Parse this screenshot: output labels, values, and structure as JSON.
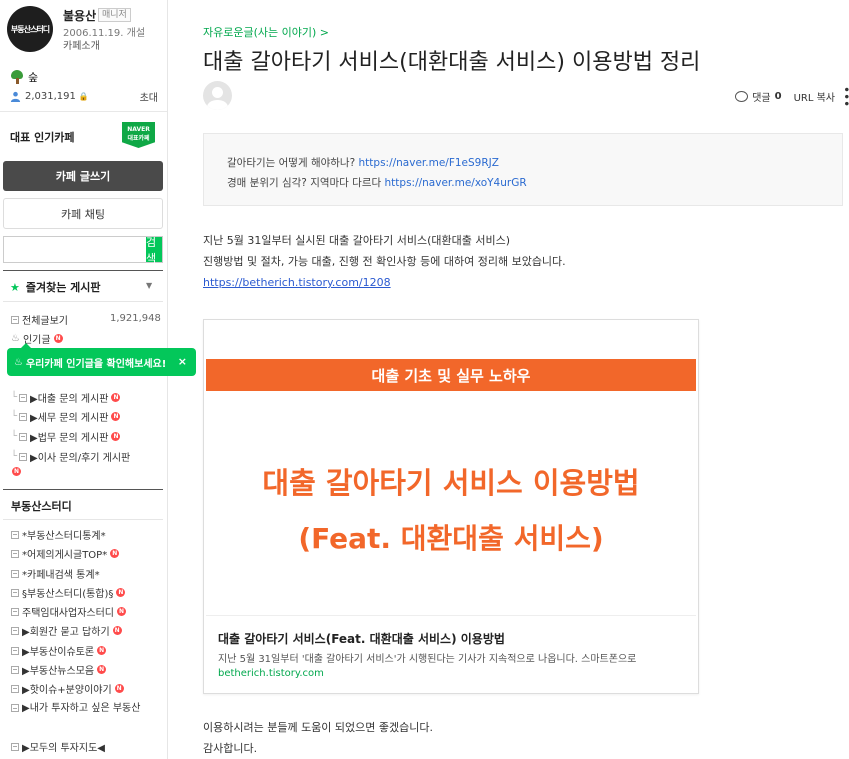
{
  "cafe": {
    "logo_text": "부동산스터디",
    "name": "불용산",
    "manager_label": "매니저",
    "founded": "2006.11.19. 개설",
    "intro_link": "카페소개",
    "rank_label": "숲",
    "member_count": "2,031,191",
    "invite_label": "초대",
    "popular_cafe_label": "대표 인기카페",
    "naver_badge_line1": "NAVER",
    "naver_badge_line2": "대표카페"
  },
  "actions": {
    "write_label": "카페 글쓰기",
    "chat_label": "카페 채팅",
    "search_placeholder": "",
    "search_button": "검색"
  },
  "favorites": {
    "title": "즐겨찾는 게시판"
  },
  "boards": {
    "all_posts": "전체글보기",
    "all_posts_count": "1,921,948",
    "popular": "인기글",
    "toast_text": "우리카페 인기글을 확인해보세요!",
    "toast_close": "×",
    "sub_items": [
      "▶대출 문의 게시판",
      "▶세무 문의 게시판",
      "▶법무 문의 게시판",
      "▶이사 문의/후기 게시판"
    ],
    "group_title": "부동산스터디",
    "group_items": [
      "*부동산스터디통계*",
      "*어제의게시글TOP*",
      "*카페내검색 통계*",
      "§부동산스터디(통합)§",
      "주택임대사업자스터디",
      "▶회원간 묻고 답하기",
      "▶부동산이슈토론",
      "▶부동산뉴스모음",
      "▶핫이슈+분양이야기",
      "▶내가 투자하고 싶은 부동산",
      "▶모두의 투자지도◀"
    ],
    "new_badge": "N"
  },
  "article": {
    "breadcrumb": "자유로운글(사는 이야기) >",
    "title": "대출 갈아타기 서비스(대환대출 서비스) 이용방법 정리",
    "comment_label": "댓글",
    "comment_count": "0",
    "url_copy": "URL 복사",
    "more": "⋮",
    "quote_line1_text": "갈아타기는 어떻게 해야하나?",
    "quote_line1_link": "https://naver.me/F1eS9RJZ",
    "quote_line2_text": "경매 분위기 심각? 지역마다 다르다",
    "quote_line2_link": "https://naver.me/xoY4urGR",
    "body_line1": "지난 5월 31일부터 실시된 대출 갈아타기 서비스(대환대출 서비스)",
    "body_line2": "진행방법 및 절차, 가능 대출, 진행 전 확인사항 등에 대하여 정리해 보았습니다.",
    "body_link": "https://betherich.tistory.com/1208",
    "card": {
      "banner": "대출 기초 및 실무 노하우",
      "hero_line1": "대출 갈아타기 서비스 이용방법",
      "hero_line2": "(Feat. 대환대출 서비스)",
      "title": "대출 갈아타기 서비스(Feat. 대환대출 서비스) 이용방법",
      "description": "지난 5월 31일부터 '대출 갈아타기 서비스'가 시행된다는 기사가 지속적으로 나옵니다. 스마트폰으로",
      "domain": "betherich.tistory.com"
    },
    "closing_line1": "이용하시려는 분들께 도움이 되었으면 좋겠습니다.",
    "closing_line2": "감사합니다."
  },
  "colors": {
    "accent_green": "#03c75a",
    "new_red": "#ff4b4b",
    "card_orange": "#f2672a",
    "link_blue": "#2a6ad0"
  }
}
